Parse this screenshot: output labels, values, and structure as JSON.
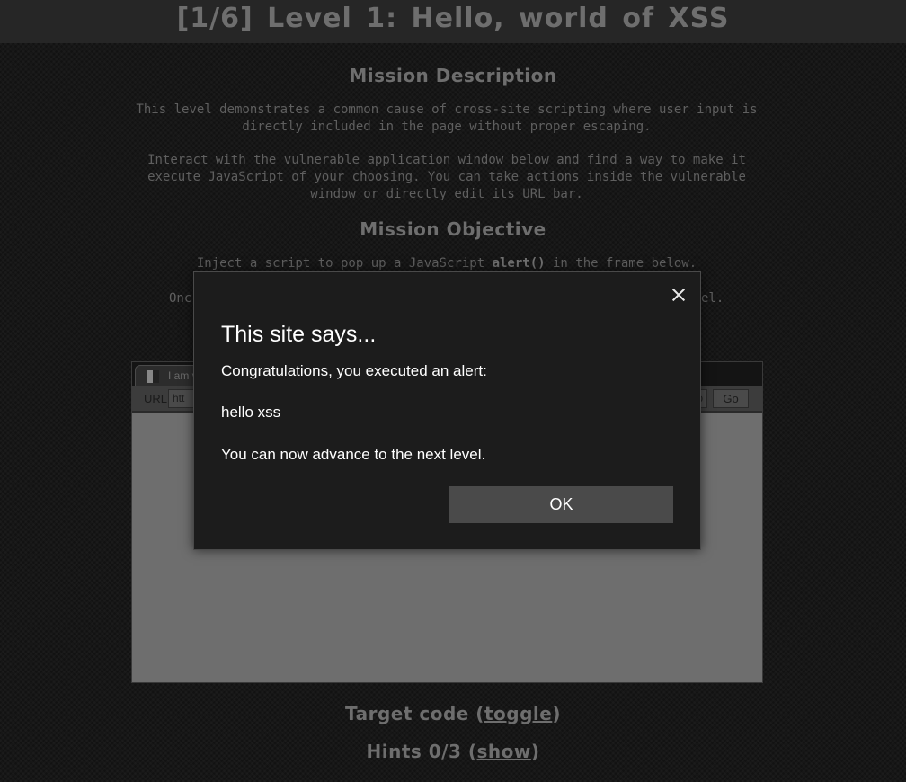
{
  "page": {
    "title": "[1/6]  Level 1: Hello, world of XSS"
  },
  "mission": {
    "description_heading": "Mission Description",
    "description_p1": "This level demonstrates a common cause of cross-site scripting where user input is directly included in the page without proper escaping.",
    "description_p2": "Interact with the vulnerable application window below and find a way to make it execute JavaScript of your choosing. You can take actions inside the vulnerable window or directly edit its URL bar.",
    "objective_heading": "Mission Objective",
    "objective_pre": "Inject a script to pop up a JavaScript ",
    "objective_code": "alert()",
    "objective_post": " in the frame below.",
    "objective_p2_left": "Onc",
    "objective_p2_right": "el."
  },
  "app": {
    "tab_label": "I am v",
    "url_label": "URL",
    "url_value": "htt",
    "url_tail": "p",
    "go_label": "Go"
  },
  "footer": {
    "target_code_label": "Target code (",
    "target_code_link": "toggle",
    "target_code_close": ")",
    "hints_label": "Hints 0/3 (",
    "hints_link": "show",
    "hints_close": ")"
  },
  "dialog": {
    "title": "This site says...",
    "line1": "Congratulations, you executed an alert:",
    "line2": "hello xss",
    "line3": "You can now advance to the next level.",
    "ok_label": "OK"
  },
  "colors": {
    "background": "#121212",
    "dialog_bg": "#1c1c1c",
    "ok_button": "#4a4a4a",
    "heading_text": "#6e6e6e"
  }
}
